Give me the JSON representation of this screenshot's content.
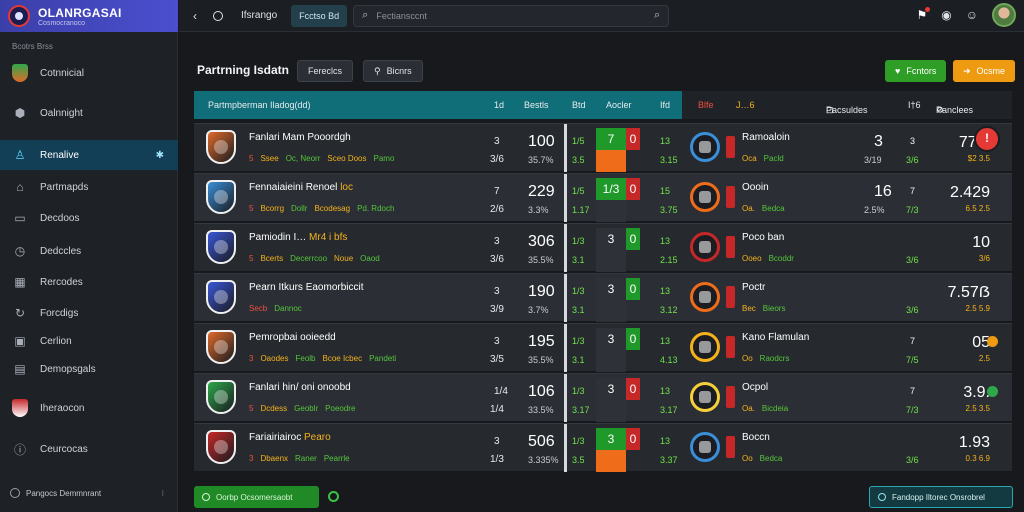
{
  "app": {
    "title": "OLANRGASAI",
    "subtitle": "Cosmocranoco"
  },
  "sidebar": {
    "section": "Bcotrs Brss",
    "items": [
      {
        "label": "Cotnnicial",
        "icon": "crest-icon"
      },
      {
        "label": "Oalnnight",
        "icon": "cube-icon"
      },
      {
        "label": "Renalive",
        "icon": "person-icon",
        "trail": "✱",
        "active": true
      },
      {
        "label": "Partmapds",
        "icon": "home-icon"
      },
      {
        "label": "Decdoos",
        "icon": "folder-icon"
      },
      {
        "label": "Dedccles",
        "icon": "clock-icon"
      },
      {
        "label": "Rercodes",
        "icon": "calendar-icon"
      },
      {
        "label": "Forcdigs",
        "icon": "sync-icon"
      },
      {
        "label": "Cerlion",
        "icon": "monitor-icon"
      },
      {
        "label": "Demopsgals",
        "icon": "grid-icon"
      },
      {
        "label": "Iheraocon",
        "icon": "crest-icon"
      },
      {
        "label": "Ceurcocas",
        "icon": "info-icon"
      }
    ],
    "footer": "Pangocs Demmnrant"
  },
  "topbar": {
    "back": "‹",
    "crumb": "Ifsrango",
    "tab": "Fcctso Bd",
    "search_placeholder": "Fectiansccnt",
    "icons": [
      "share-icon",
      "alert-icon",
      "help-icon"
    ]
  },
  "header": {
    "title": "Partrning Isdatn",
    "btn_a": "Fereclcs",
    "btn_b": "Bicnrs",
    "btn_green": "Fcntors",
    "btn_orange": "Ocsme"
  },
  "table_head": {
    "team": "Partmpberman Iladog(dd)",
    "c1": "1d",
    "c2": "Bestls",
    "c3": "Btd",
    "c4": "Aocler",
    "c5": "Ifd",
    "c6": "Blfe",
    "c7": "J…6",
    "c8": "Pacsuldes",
    "c9": "I†6",
    "c10": "Panclees"
  },
  "rows": [
    {
      "name": "Fanlari Mam Pooordgh",
      "hl": "",
      "sub": [
        "5",
        "Ssee",
        "Oc, Neorr",
        "Sceo Doos",
        "Pamo"
      ],
      "a": "3",
      "av": "100",
      "b": "3/6",
      "bv": "35.7%",
      "g1": "1/5",
      "g2": "3.5",
      "left": "7",
      "mid": "0",
      "gr": "13",
      "gr2": "3.15",
      "aname": "Ramoaloin",
      "asub": [
        "Oca",
        "Pacld"
      ],
      "n1": "3",
      "n2": "3/19",
      "n3": "3",
      "n4": "3/6",
      "rv": "772.",
      "rs": "$2 3.5",
      "mark": "ring",
      "colors": [
        "#1f9a2a",
        "#c62828",
        "#ef6c1a"
      ],
      "crest": "#e06a2a",
      "badge": "#3a8fd8"
    },
    {
      "name": "Fennaiaieini Renoel",
      "hl": "loc",
      "sub": [
        "5",
        "Bcorrg",
        "Dollr",
        "Bcodesag",
        "Pd. Rdoch"
      ],
      "a": "7",
      "av": "229",
      "b": "2/6",
      "bv": "3.3%",
      "g1": "1/5",
      "g2": "1.17",
      "left": "1/3",
      "mid": "0",
      "gr": "15",
      "gr2": "3.75",
      "aname": "Oooin",
      "asub": [
        "Oa.",
        "Bedca"
      ],
      "n1": "16",
      "n2": "2.5%",
      "n3": "7",
      "n4": "7/3",
      "rv": "2.429",
      "rs": "6.5 2.5",
      "mark": "none",
      "colors": [
        "#1f9a2a",
        "#c62828",
        "#2e3238"
      ],
      "crest": "#3a8fd8",
      "badge": "#ef6c1a"
    },
    {
      "name": "Pamiodin I…",
      "hl": "Mr4 i bfs",
      "sub": [
        "5",
        "Bcerts",
        "Decerrcoo",
        "Noue",
        "Oaod"
      ],
      "a": "3",
      "av": "306",
      "b": "3/6",
      "bv": "35.5%",
      "g1": "1/3",
      "g2": "3.1",
      "left": "3",
      "mid": "0",
      "gr": "13",
      "gr2": "2.15",
      "aname": "Poco ban",
      "asub": [
        "Ooeo",
        "Bcoddr"
      ],
      "n1": "",
      "n2": "",
      "n3": "",
      "n4": "3/6",
      "rv": "10",
      "rs": "3/6",
      "mark": "none",
      "colors": [
        "#2e3238",
        "#1f9a2a",
        "#2e3238"
      ],
      "crest": "#3a56d8",
      "badge": "#c62828"
    },
    {
      "name": "Pearn Itkurs Eaomorbiccit",
      "hl": "",
      "sub": [
        "Secb",
        "Dannoc"
      ],
      "a": "3",
      "av": "190",
      "b": "3/9",
      "bv": "3.7%",
      "g1": "1/3",
      "g2": "3.1",
      "left": "3",
      "mid": "0",
      "gr": "13",
      "gr2": "3.12",
      "aname": "Poctr",
      "asub": [
        "Bec",
        "Bieors"
      ],
      "n1": "",
      "n2": "",
      "n3": "",
      "n4": "3/6",
      "rv": "7.57ẞ",
      "rs": "2.5 5.9",
      "mark": "none",
      "colors": [
        "#2e3238",
        "#1f9a2a",
        "#2e3238"
      ],
      "crest": "#3a56d8",
      "badge": "#ef6c1a"
    },
    {
      "name": "Pemropbai ooieedd",
      "hl": "",
      "sub": [
        "3",
        "Oaodes",
        "Feolb",
        "Bcoe Icbec",
        "Pandeti"
      ],
      "a": "3",
      "av": "195",
      "b": "3/5",
      "bv": "35.5%",
      "g1": "1/3",
      "g2": "3.1",
      "left": "3",
      "mid": "0",
      "gr": "13",
      "gr2": "4.13",
      "aname": "Kano Flamulan",
      "asub": [
        "Oo",
        "Raodcrs"
      ],
      "n1": "",
      "n2": "",
      "n3": "7",
      "n4": "7/5",
      "rv": "05",
      "rs": "2.5",
      "mark": "orange",
      "colors": [
        "#2e3238",
        "#1f9a2a",
        "#2e3238"
      ],
      "crest": "#e06a2a",
      "badge": "#f5b21b"
    },
    {
      "name": "Fanlari hin/ oni onoobd",
      "hl": "",
      "sub": [
        "5",
        "Dcdess",
        "Geoblr",
        "Poeodre"
      ],
      "a": "1/4",
      "av": "106",
      "b": "1/4",
      "bv": "33.5%",
      "g1": "1/3",
      "g2": "3.17",
      "left": "3",
      "mid": "0",
      "gr": "13",
      "gr2": "3.17",
      "aname": "Ocpol",
      "asub": [
        "Oa.",
        "Bicdeia"
      ],
      "n1": "",
      "n2": "",
      "n3": "7",
      "n4": "7/3",
      "rv": "3.9.",
      "rs": "2.5 3.5",
      "mark": "green",
      "colors": [
        "#2e3238",
        "#c62828",
        "#2e3238"
      ],
      "crest": "#2ea84a",
      "badge": "#f5d03b"
    },
    {
      "name": "Fariairiairoc",
      "hl": "Pearo",
      "sub": [
        "3",
        "Dbaenx",
        "Raner",
        "Pearrle"
      ],
      "a": "3",
      "av": "506",
      "b": "1/3",
      "bv": "3.335%",
      "g1": "1/3",
      "g2": "3.5",
      "left": "3",
      "mid": "0",
      "gr": "13",
      "gr2": "3.37",
      "aname": "Boccn",
      "asub": [
        "Oo",
        "Bedca"
      ],
      "n1": "",
      "n2": "",
      "n3": "",
      "n4": "3/6",
      "rv": "1.93",
      "rs": "0.3 6.9",
      "mark": "none",
      "colors": [
        "#1f9a2a",
        "#c62828",
        "#ef6c1a"
      ],
      "crest": "#c62828",
      "badge": "#3a8fd8"
    }
  ],
  "footer": {
    "left_btn": "Oorbp Ocsomersaobt",
    "right_btn": "Fandopp Iltorec Onsrobrel"
  }
}
